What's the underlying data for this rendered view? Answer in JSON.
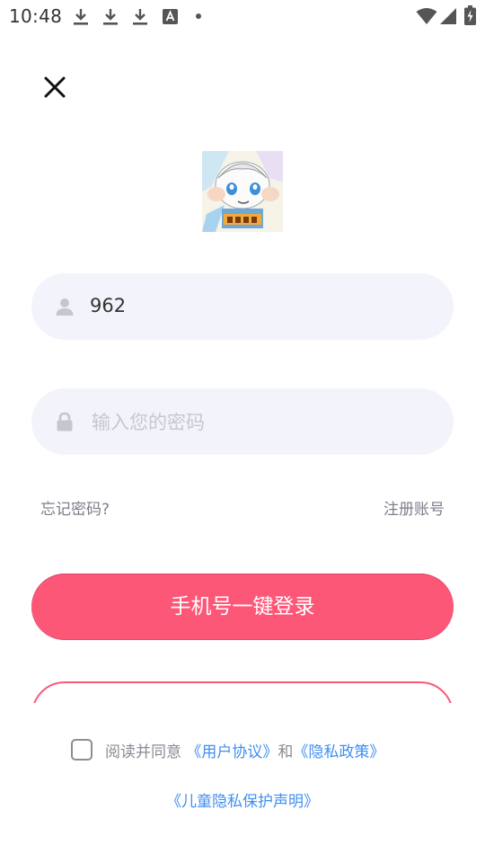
{
  "status_bar": {
    "time": "10:48",
    "icons": [
      "download-icon",
      "download-icon",
      "download-icon",
      "font-icon",
      "dot",
      "wifi-icon",
      "signal-icon",
      "battery-charging-icon"
    ]
  },
  "login": {
    "close_icon": "close-icon",
    "username": {
      "icon": "user-icon",
      "value": "962"
    },
    "password": {
      "icon": "lock-icon",
      "placeholder": "输入您的密码"
    },
    "forgot_password": "忘记密码?",
    "register": "注册账号",
    "one_click_login": "手机号一键登录",
    "agreement": {
      "prefix": "阅读并同意",
      "user_agreement": "《用户协议》",
      "and": "和",
      "privacy_policy": "《隐私政策》",
      "child_privacy": "《儿童隐私保护声明》"
    }
  },
  "colors": {
    "accent": "#fd5778",
    "link": "#3f8ff0",
    "field_bg": "#f3f4fb",
    "muted_text": "#7d7d8a"
  }
}
